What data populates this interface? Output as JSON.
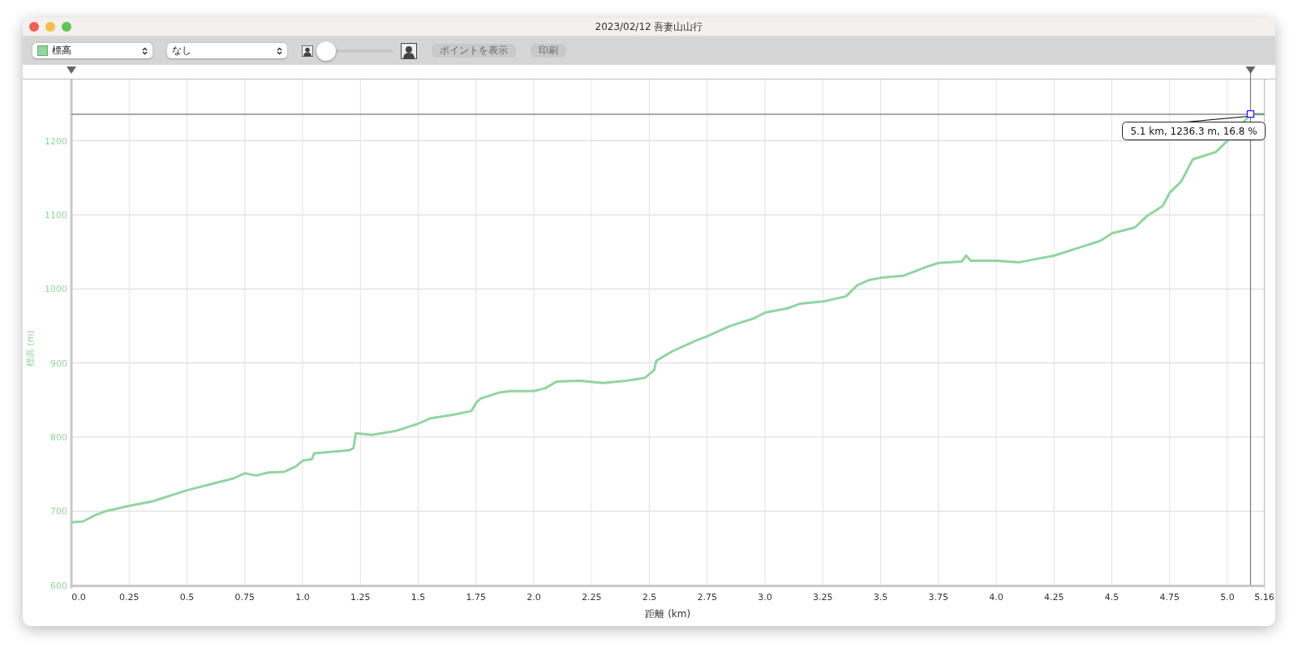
{
  "window": {
    "title": "2023/02/12 吾妻山山行"
  },
  "toolbar": {
    "compare_select": {
      "value": "なし"
    },
    "zoom_slider": {
      "level": 0
    },
    "buttons": [
      "ポイントを表示",
      "印刷"
    ]
  },
  "chart": {
    "chart_data": {
      "type": "line",
      "xlabel": "距離 (km)",
      "ylabel": "標高 (m)",
      "x": [
        0,
        0.05,
        0.1,
        0.15,
        0.25,
        0.35,
        0.5,
        0.6,
        0.7,
        0.75,
        0.8,
        0.85,
        0.92,
        0.97,
        1.0,
        1.04,
        1.05,
        1.2,
        1.22,
        1.23,
        1.3,
        1.4,
        1.5,
        1.55,
        1.65,
        1.73,
        1.75,
        1.77,
        1.85,
        1.9,
        2.0,
        2.05,
        2.1,
        2.2,
        2.3,
        2.4,
        2.48,
        2.52,
        2.53,
        2.6,
        2.7,
        2.75,
        2.85,
        2.95,
        3.0,
        3.1,
        3.15,
        3.25,
        3.35,
        3.4,
        3.45,
        3.5,
        3.6,
        3.7,
        3.75,
        3.85,
        3.87,
        3.89,
        4.0,
        4.1,
        4.25,
        4.35,
        4.45,
        4.5,
        4.6,
        4.65,
        4.72,
        4.75,
        4.8,
        4.85,
        4.9,
        4.95,
        5.0,
        5.1,
        5.16
      ],
      "series": [
        {
          "name": "標高",
          "color": "#92d4a2",
          "values": [
            685,
            686,
            694,
            700,
            707,
            713,
            728,
            736,
            744,
            751,
            748,
            752,
            753,
            760,
            768,
            770,
            778,
            782,
            785,
            805,
            803,
            808,
            818,
            825,
            830,
            835,
            846,
            852,
            860,
            862,
            862,
            866,
            875,
            876,
            873,
            876,
            880,
            890,
            903,
            916,
            930,
            936,
            950,
            960,
            968,
            974,
            980,
            983,
            990,
            1005,
            1012,
            1015,
            1018,
            1030,
            1035,
            1037,
            1045,
            1038,
            1038,
            1036,
            1045,
            1055,
            1065,
            1075,
            1083,
            1098,
            1112,
            1130,
            1145,
            1175,
            1180,
            1185,
            1200,
            1236,
            1236
          ]
        }
      ],
      "xlim": [
        0,
        5.16
      ],
      "ylim": [
        600,
        1283
      ],
      "xticks": [
        {
          "value": 0,
          "label": "0.0"
        },
        0.25,
        0.5,
        0.75,
        {
          "value": 1,
          "label": "1.0"
        },
        1.25,
        1.5,
        1.75,
        {
          "value": 2,
          "label": "2.0"
        },
        2.25,
        2.5,
        2.75,
        {
          "value": 3,
          "label": "3.0"
        },
        3.25,
        3.5,
        3.75,
        {
          "value": 4,
          "label": "4.0"
        },
        4.25,
        4.5,
        4.75,
        {
          "value": 5,
          "label": "5.0"
        },
        5.16
      ],
      "yticks": [
        600,
        700,
        800,
        900,
        1000,
        1100,
        1200
      ],
      "grid": true,
      "ref_lines": [
        {
          "axis": "y",
          "value": 1236
        },
        {
          "axis": "x",
          "value": 5.1
        }
      ],
      "annotations": [
        {
          "x": 5.1,
          "y": 1236.3,
          "text": "5.1 km, 1236.3 m, 16.8 %"
        }
      ]
    }
  }
}
